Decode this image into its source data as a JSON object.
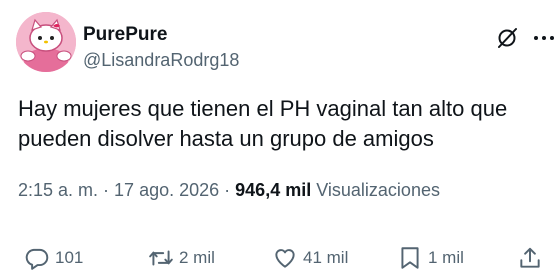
{
  "author": {
    "name": "PurePure",
    "handle": "@LisandraRodrg18"
  },
  "tweet": {
    "text": "Hay mujeres que tienen el PH vaginal tan alto que pueden disolver hasta un grupo de amigos",
    "time": "2:15 a. m.",
    "separator1": " · ",
    "date": "17 ago. 2026",
    "separator2": " · ",
    "views_count": "946,4 mil",
    "views_label": " Visualizaciones"
  },
  "actions": {
    "replies": "101",
    "retweets": "2 mil",
    "likes": "41 mil",
    "bookmarks": "1 mil"
  },
  "icons": {
    "avatar": "pink-cartoon-avatar",
    "top_right": [
      "grok-icon",
      "more-icon"
    ],
    "bar": [
      "reply-icon",
      "retweet-icon",
      "like-icon",
      "bookmark-icon",
      "share-icon"
    ]
  },
  "colors": {
    "text": "#0f1419",
    "secondary": "#536471",
    "avatar_bg": "#f2a7c3"
  }
}
